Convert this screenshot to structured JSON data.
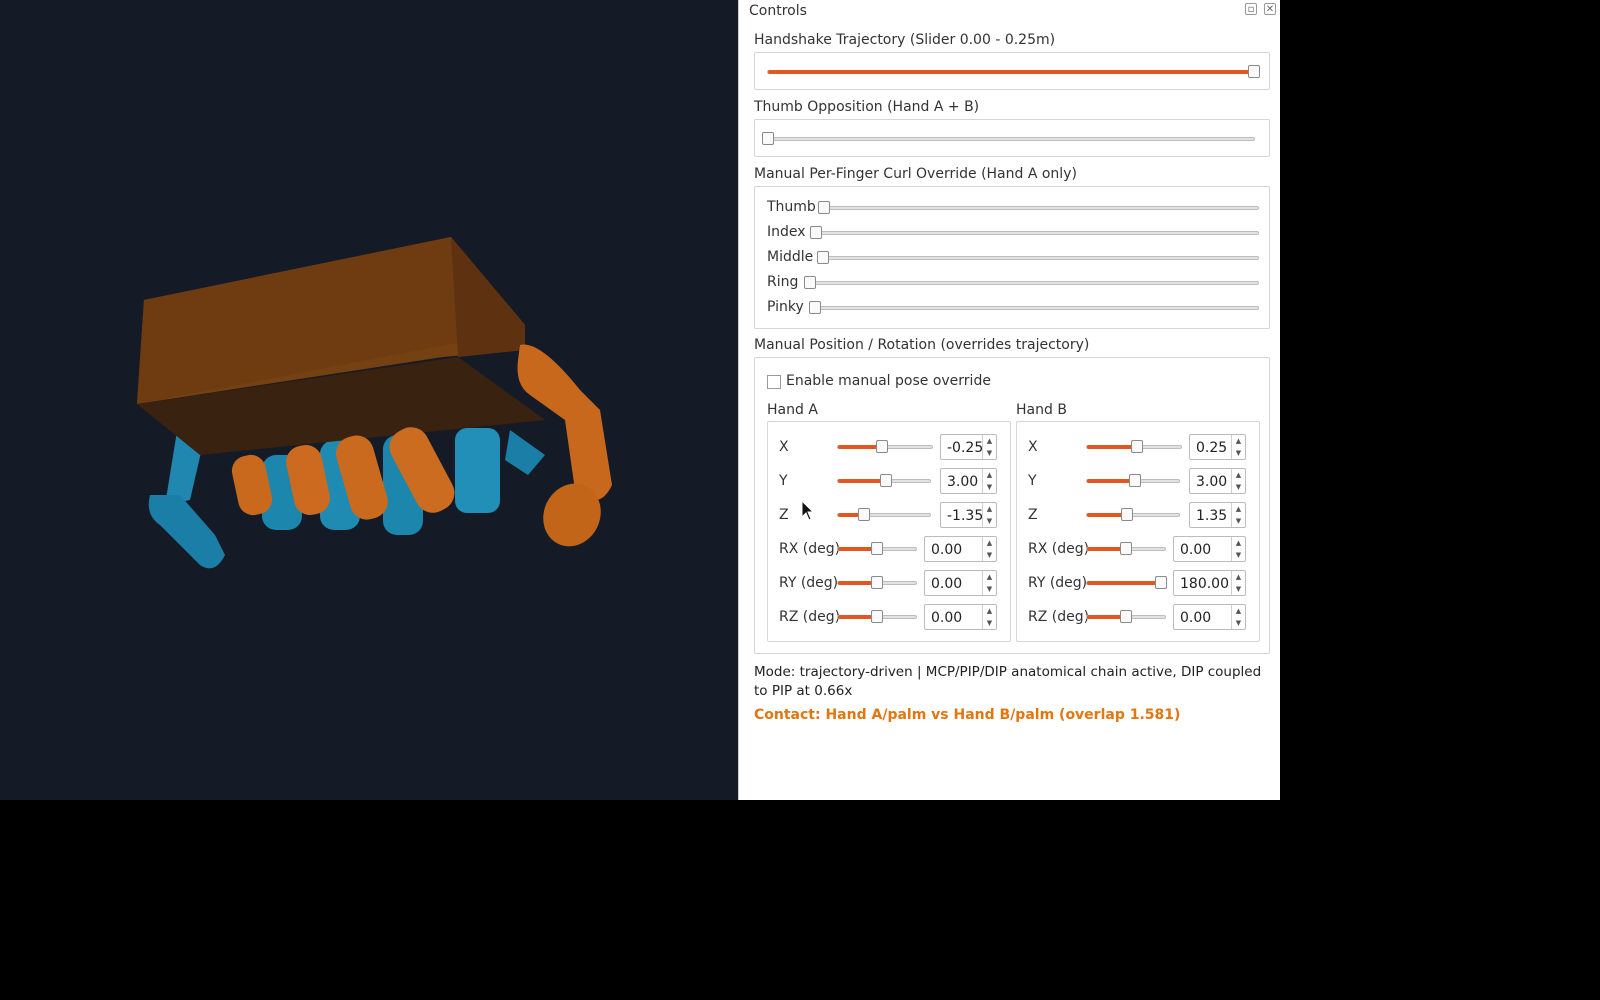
{
  "dock": {
    "title": "Controls",
    "float_icon": "float-icon",
    "close_icon": "close-icon"
  },
  "trajectory": {
    "label": "Handshake Trajectory (Slider 0.00 - 0.25m)",
    "value_fraction": 1.0
  },
  "thumb_opposition": {
    "label": "Thumb Opposition (Hand A + B)",
    "value_fraction": 0.0
  },
  "finger_curl": {
    "label": "Manual Per-Finger Curl Override (Hand A only)",
    "fingers": [
      {
        "label": "Thumb",
        "value_fraction": 0.0
      },
      {
        "label": "Index",
        "value_fraction": 0.0
      },
      {
        "label": "Middle",
        "value_fraction": 0.0
      },
      {
        "label": "Ring",
        "value_fraction": 0.0
      },
      {
        "label": "Pinky",
        "value_fraction": 0.0
      }
    ]
  },
  "manual_pose": {
    "label": "Manual Position / Rotation (overrides trajectory)",
    "enable_label": "Enable manual pose override",
    "enabled": false,
    "hand_a": {
      "title": "Hand A",
      "controls": [
        {
          "label": "X",
          "value": "-0.25",
          "slider_fraction": 0.47
        },
        {
          "label": "Y",
          "value": "3.00",
          "slider_fraction": 0.52
        },
        {
          "label": "Z",
          "value": "-1.35",
          "slider_fraction": 0.28
        },
        {
          "label": "RX (deg)",
          "value": "0.00",
          "slider_fraction": 0.5
        },
        {
          "label": "RY (deg)",
          "value": "0.00",
          "slider_fraction": 0.5
        },
        {
          "label": "RZ (deg)",
          "value": "0.00",
          "slider_fraction": 0.5
        }
      ]
    },
    "hand_b": {
      "title": "Hand B",
      "controls": [
        {
          "label": "X",
          "value": "0.25",
          "slider_fraction": 0.53
        },
        {
          "label": "Y",
          "value": "3.00",
          "slider_fraction": 0.52
        },
        {
          "label": "Z",
          "value": "1.35",
          "slider_fraction": 0.44
        },
        {
          "label": "RX (deg)",
          "value": "0.00",
          "slider_fraction": 0.5
        },
        {
          "label": "RY (deg)",
          "value": "180.00",
          "slider_fraction": 1.0
        },
        {
          "label": "RZ (deg)",
          "value": "0.00",
          "slider_fraction": 0.5
        }
      ]
    }
  },
  "status": {
    "mode": "Mode: trajectory-driven | MCP/PIP/DIP anatomical chain active, DIP coupled to PIP at 0.66x",
    "contact": "Contact: Hand A/palm vs Hand B/palm (overlap 1.581)"
  },
  "colors": {
    "viewport_bg": "#151b26",
    "hand_orange": "#c9691e",
    "hand_blue": "#1f8fb8",
    "slider_accent": "#e2561f",
    "contact_text": "#e3760f"
  }
}
